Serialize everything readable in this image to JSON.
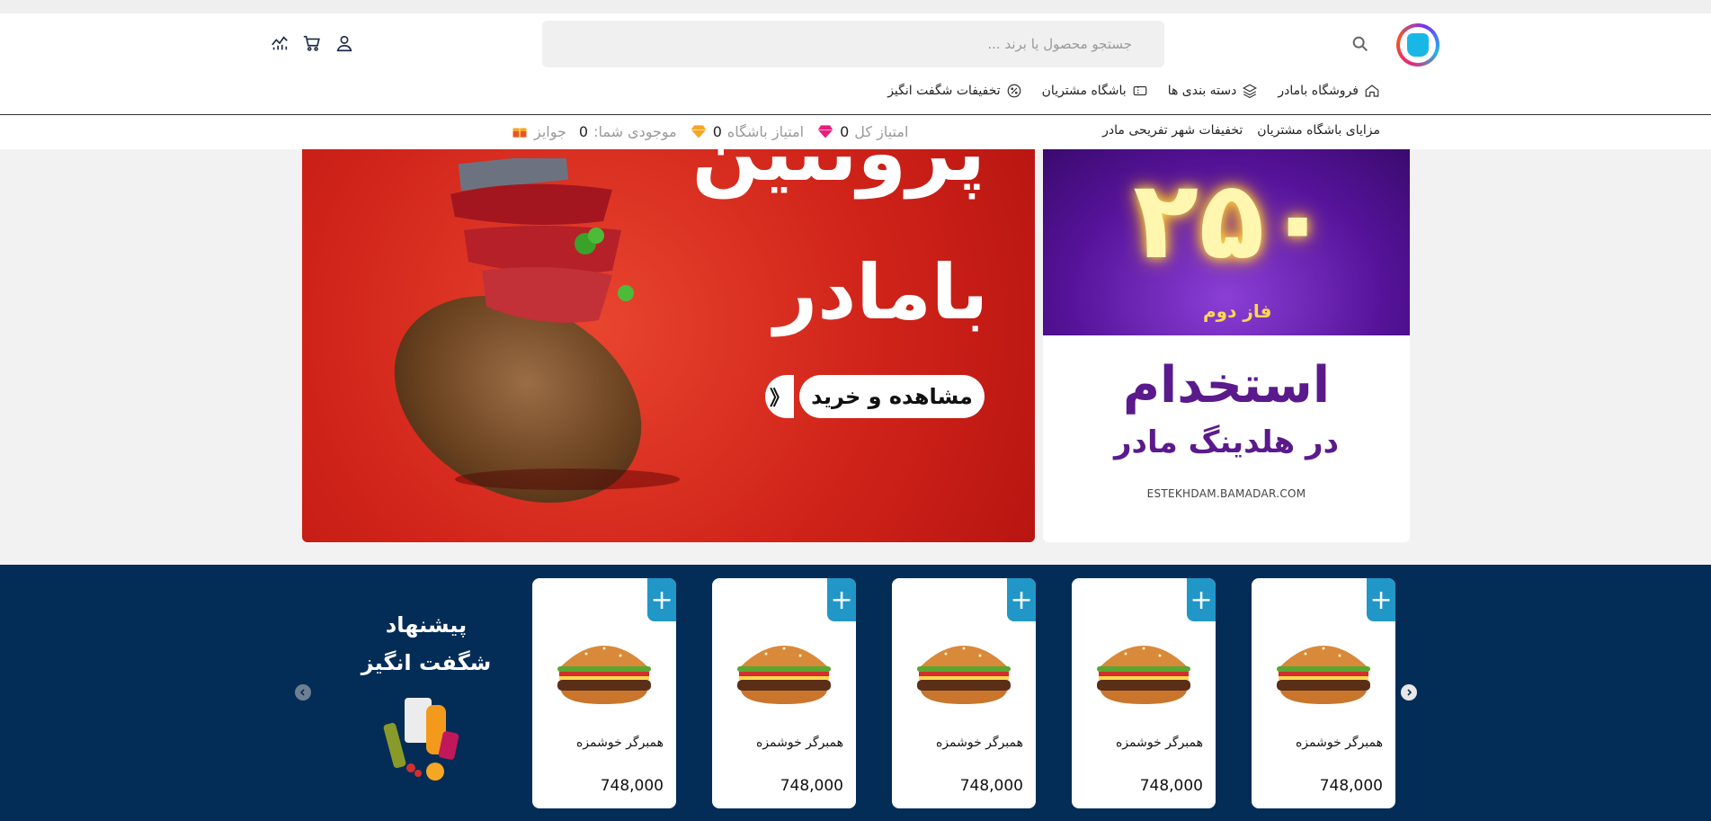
{
  "header": {
    "search_placeholder": "جستجو محصول یا برند ...",
    "icons": [
      "logo",
      "search-icon",
      "stats-icon",
      "cart-icon",
      "user-icon"
    ]
  },
  "nav": {
    "items": [
      {
        "label": "فروشگاه بامادر",
        "icon": "home-icon"
      },
      {
        "label": "دسته بندی ها",
        "icon": "layers-icon"
      },
      {
        "label": "باشگاه مشتریان",
        "icon": "ticket-icon"
      },
      {
        "label": "تخفیفات شگفت انگیز",
        "icon": "discount-badge-icon"
      }
    ]
  },
  "subbar": {
    "links": [
      "مزایای باشگاه مشتریان",
      "تخفیفات شهر تفریحی مادر"
    ],
    "stats": [
      {
        "label": "امتیاز کل",
        "value": "0",
        "icon": "pink-gem-icon"
      },
      {
        "label": "امتیاز باشگاه",
        "value": "0",
        "icon": "orange-gem-icon"
      },
      {
        "label": "موجودی شما:",
        "value": "0",
        "icon": ""
      },
      {
        "label": "جوایز",
        "value": "",
        "icon": "gift-icon"
      }
    ]
  },
  "banner_main": {
    "headline1": "پروتئین",
    "headline2": "بامادر",
    "cta": "مشاهده و خرید",
    "arrow": "《"
  },
  "banner_side": {
    "big_number": "۲۵۰",
    "phase": "فاز دوم",
    "hire": "استخدام",
    "hire_sub": "در هلدینگ مادر",
    "url": "ESTEKHDAM.BAMADAR.COM"
  },
  "deals": {
    "title_line1": "پیشنهاد",
    "title_line2": "شگفت انگیز",
    "products": [
      {
        "name": "همبرگر خوشمزه",
        "price": "748,000"
      },
      {
        "name": "همبرگر خوشمزه",
        "price": "748,000"
      },
      {
        "name": "همبرگر خوشمزه",
        "price": "748,000"
      },
      {
        "name": "همبرگر خوشمزه",
        "price": "748,000"
      },
      {
        "name": "همبرگر خوشمزه",
        "price": "748,000"
      }
    ]
  },
  "colors": {
    "deals_bg": "#032d57",
    "plus_btn": "#2197c8",
    "banner_red": "#d1241a",
    "side_purple": "#56139a"
  }
}
